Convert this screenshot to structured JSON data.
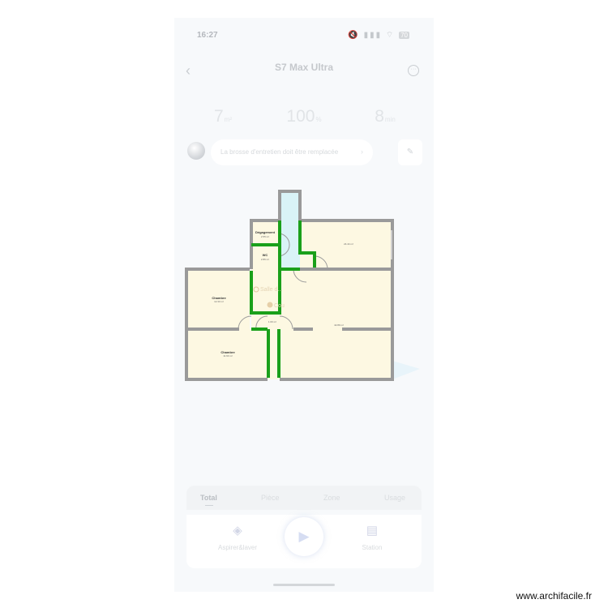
{
  "status_bar": {
    "time": "16:27",
    "icons": "🔇 ▮▮▮ ⌔",
    "battery": "70"
  },
  "header": {
    "back_icon": "chevron-left-icon",
    "title": "S7 Max Ultra",
    "subtitle": "",
    "more_icon": "ellipsis-icon"
  },
  "stats": [
    {
      "value": "7",
      "unit": "m²",
      "icon": "area-icon"
    },
    {
      "value": "100",
      "unit": "%",
      "icon": "battery-icon"
    },
    {
      "value": "8",
      "unit": "min",
      "icon": "clock-icon"
    }
  ],
  "notification": {
    "text": "La brosse d'entretien doit être remplacée",
    "chevron": "›"
  },
  "edit_icon": "edit-icon",
  "map": {
    "rooms": [
      {
        "name": "Dégagement",
        "area": "2.55 m²"
      },
      {
        "name": "WC",
        "area": "2.86 m²"
      },
      {
        "name": "",
        "area": "24.44 m²"
      },
      {
        "name": "Chambre",
        "area": "12.33 m²"
      },
      {
        "name": "Chambre",
        "area": "11.63 m²"
      },
      {
        "name": "",
        "area": "42.89 m²"
      },
      {
        "name": "",
        "area": "1.60 m²"
      }
    ],
    "overlay_labels": {
      "room": "Salle d...",
      "marker": "Cou"
    },
    "colors": {
      "wall": "#9a9a9a",
      "wall_highlight": "#1aa01a",
      "floor": "#fdf8e2",
      "water": "#d9f3f7"
    }
  },
  "tabs": [
    {
      "label": "Total",
      "active": true
    },
    {
      "label": "Pièce",
      "active": false
    },
    {
      "label": "Zone",
      "active": false
    },
    {
      "label": "Usage",
      "active": false
    }
  ],
  "actions": [
    {
      "label": "Aspirer&laver",
      "icon": "vacuum-mop-icon"
    },
    {
      "label": "",
      "icon": "play-icon"
    },
    {
      "label": "Station",
      "icon": "station-icon"
    }
  ],
  "watermark": "www.archifacile.fr"
}
